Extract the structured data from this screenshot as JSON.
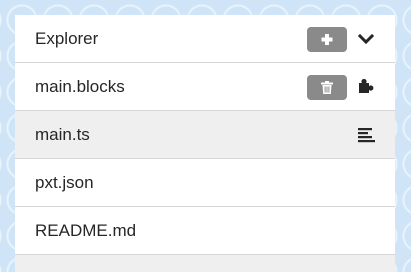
{
  "explorer": {
    "title": "Explorer",
    "add_button": "plus-icon",
    "collapse_icon": "chevron-down-icon",
    "files": [
      {
        "name": "main.blocks",
        "icon": "puzzle-icon",
        "has_delete": true,
        "delete_icon": "trash-icon"
      },
      {
        "name": "main.ts",
        "icon": "align-left-icon",
        "selected": true
      },
      {
        "name": "pxt.json"
      },
      {
        "name": "README.md"
      }
    ]
  },
  "colors": {
    "background": "#cfe5f7",
    "panel": "#ffffff",
    "selected_row": "#efefef",
    "button": "#8a8a8a",
    "text": "#262626"
  }
}
